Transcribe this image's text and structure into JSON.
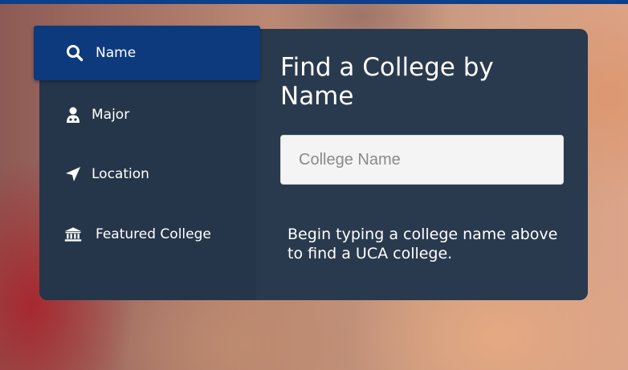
{
  "nav": {
    "items": [
      {
        "label": "Name",
        "icon": "search-icon",
        "active": true
      },
      {
        "label": "Major",
        "icon": "student-icon",
        "active": false
      },
      {
        "label": "Location",
        "icon": "location-arrow-icon",
        "active": false
      },
      {
        "label": "Featured College",
        "icon": "institution-icon",
        "active": false
      }
    ]
  },
  "main": {
    "title": "Find a College by Name",
    "search_placeholder": "College Name",
    "search_value": "",
    "hint": "Begin typing a college name above to find a UCA college."
  },
  "colors": {
    "panel": "#2a3a4e",
    "sidebar": "#26364a",
    "active_tab": "#0d3a7c",
    "top_bar": "#0d3f8a"
  }
}
